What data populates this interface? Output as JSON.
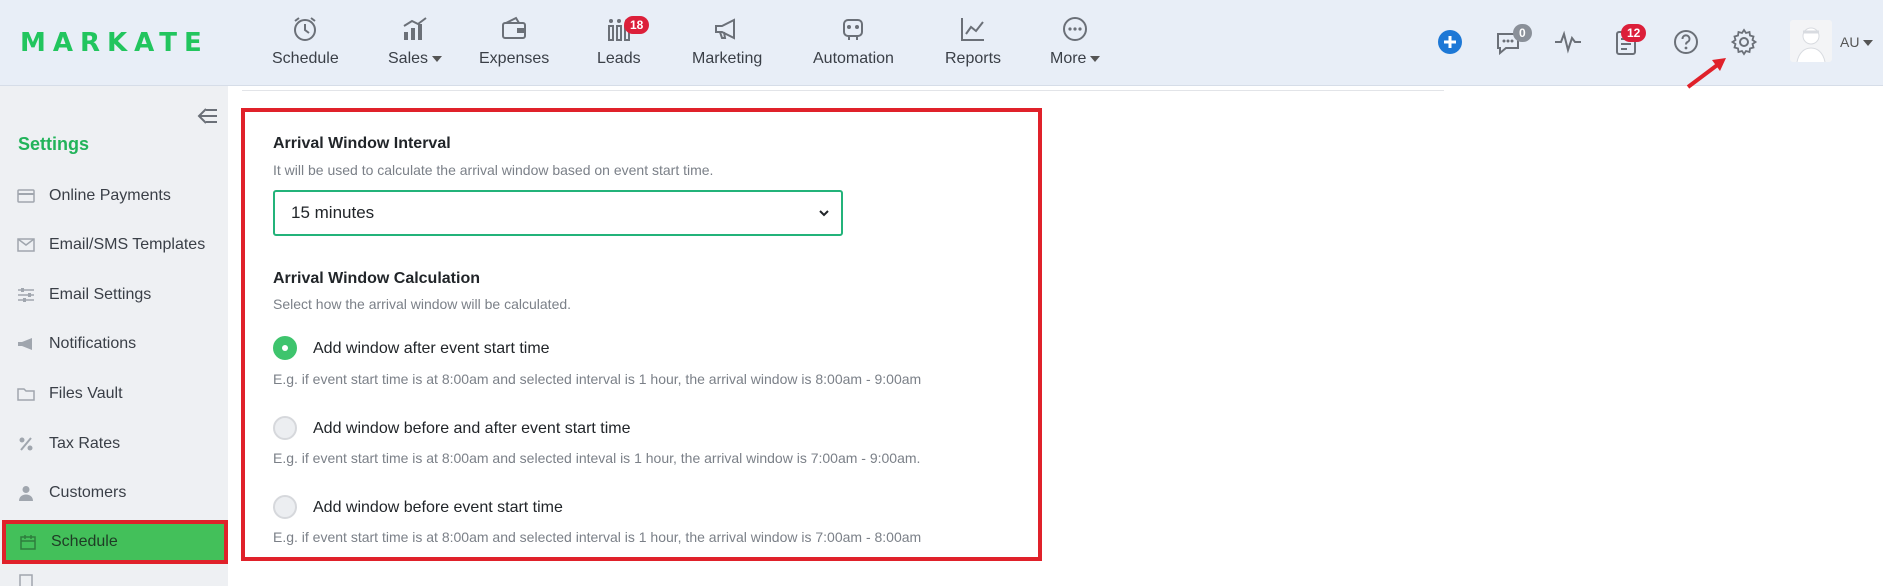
{
  "app": {
    "logo": "MARKATE",
    "brand_color": "#22c55e"
  },
  "nav": {
    "items": [
      {
        "label": "Schedule",
        "icon": "alarm-clock-icon"
      },
      {
        "label": "Sales",
        "icon": "sales-chart-icon",
        "has_dropdown": true
      },
      {
        "label": "Expenses",
        "icon": "wallet-icon"
      },
      {
        "label": "Leads",
        "icon": "leads-bars-icon",
        "badge": "18"
      },
      {
        "label": "Marketing",
        "icon": "megaphone-icon"
      },
      {
        "label": "Automation",
        "icon": "robot-icon"
      },
      {
        "label": "Reports",
        "icon": "line-chart-icon"
      },
      {
        "label": "More",
        "icon": "more-dots-icon",
        "has_dropdown": true
      }
    ],
    "right": {
      "messages_badge": "0",
      "tasks_badge": "12",
      "user_initials": "AU"
    }
  },
  "sidebar": {
    "title": "Settings",
    "items": [
      {
        "label": "Online Payments",
        "icon": "credit-card-icon"
      },
      {
        "label": "Email/SMS Templates",
        "icon": "envelope-icon"
      },
      {
        "label": "Email Settings",
        "icon": "sliders-icon"
      },
      {
        "label": "Notifications",
        "icon": "megaphone-icon"
      },
      {
        "label": "Files Vault",
        "icon": "folder-icon"
      },
      {
        "label": "Tax Rates",
        "icon": "percent-icon"
      },
      {
        "label": "Customers",
        "icon": "user-icon"
      },
      {
        "label": "Schedule",
        "icon": "calendar-icon",
        "active": true
      }
    ]
  },
  "main": {
    "interval": {
      "title": "Arrival Window Interval",
      "help": "It will be used to calculate the arrival window based on event start time.",
      "selected": "15 minutes"
    },
    "calculation": {
      "title": "Arrival Window Calculation",
      "help": "Select how the arrival window will be calculated.",
      "options": [
        {
          "label": "Add window after event start time",
          "example": "E.g. if event start time is at 8:00am and selected interval is 1 hour, the arrival window is 8:00am - 9:00am",
          "checked": true
        },
        {
          "label": "Add window before and after event start time",
          "example": "E.g. if event start time is at 8:00am and selected inteval is 1 hour, the arrival window is 7:00am - 9:00am.",
          "checked": false
        },
        {
          "label": "Add window before event start time",
          "example": "E.g. if event start time is at 8:00am and selected interval is 1 hour, the arrival window is 7:00am - 8:00am",
          "checked": false
        }
      ]
    }
  }
}
